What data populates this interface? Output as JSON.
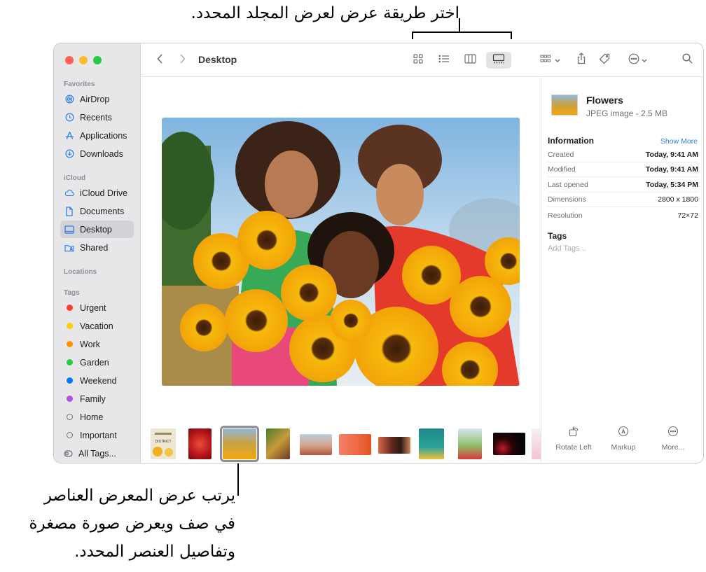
{
  "annotations": {
    "top": "اختر طريقة عرض لعرض المجلد المحدد.",
    "bottom_1": "يرتب عرض المعرض العناصر",
    "bottom_2": "في صف ويعرض صورة مصغرة",
    "bottom_3": "وتفاصيل العنصر المحدد."
  },
  "window": {
    "title": "Desktop",
    "traffic_colors": [
      "#ff5f57",
      "#febc2e",
      "#28c840"
    ]
  },
  "sidebar": {
    "favorites_label": "Favorites",
    "favorites": [
      {
        "label": "AirDrop",
        "icon": "airdrop-icon"
      },
      {
        "label": "Recents",
        "icon": "clock-icon"
      },
      {
        "label": "Applications",
        "icon": "applications-icon"
      },
      {
        "label": "Downloads",
        "icon": "download-icon"
      }
    ],
    "icloud_label": "iCloud",
    "icloud": [
      {
        "label": "iCloud Drive",
        "icon": "cloud-icon"
      },
      {
        "label": "Documents",
        "icon": "document-icon"
      },
      {
        "label": "Desktop",
        "icon": "desktop-icon",
        "selected": true
      },
      {
        "label": "Shared",
        "icon": "shared-folder-icon"
      }
    ],
    "locations_label": "Locations",
    "tags_label": "Tags",
    "tags": [
      {
        "label": "Urgent",
        "color": "#ff3b30"
      },
      {
        "label": "Vacation",
        "color": "#ffcc00"
      },
      {
        "label": "Work",
        "color": "#ff9500"
      },
      {
        "label": "Garden",
        "color": "#28cd41"
      },
      {
        "label": "Weekend",
        "color": "#007aff"
      },
      {
        "label": "Family",
        "color": "#af52de"
      },
      {
        "label": "Home",
        "color": ""
      },
      {
        "label": "Important",
        "color": ""
      },
      {
        "label": "All Tags...",
        "color": ""
      }
    ]
  },
  "toolbar": {
    "view_modes": [
      "icon-view",
      "list-view",
      "column-view",
      "gallery-view"
    ],
    "active_view": "gallery-view",
    "accent": "#2f7fea"
  },
  "inspector": {
    "name": "Flowers",
    "kind": "JPEG image - 2.5 MB",
    "information_label": "Information",
    "show_more": "Show More",
    "rows": [
      {
        "key": "Created",
        "value": "Today, 9:41 AM"
      },
      {
        "key": "Modified",
        "value": "Today, 9:41 AM"
      },
      {
        "key": "Last opened",
        "value": "Today, 5:34 PM"
      },
      {
        "key": "Dimensions",
        "value": "2800 x 1800"
      },
      {
        "key": "Resolution",
        "value": "72×72"
      }
    ],
    "tags_label": "Tags",
    "tags_placeholder": "Add Tags...",
    "actions": [
      "Rotate Left",
      "Markup",
      "More..."
    ]
  },
  "gallery": {
    "thumb_label_district": "DISTRICT",
    "selected_index": 2
  }
}
